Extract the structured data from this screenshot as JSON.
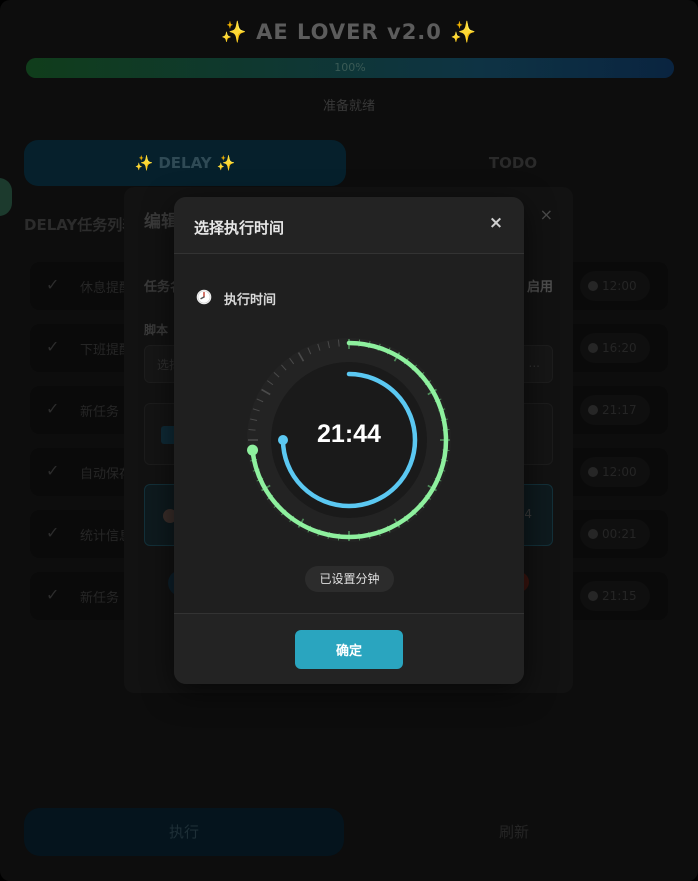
{
  "app": {
    "title": "✨ AE LOVER v2.0 ✨",
    "progress": {
      "percent": 100,
      "text": "100%"
    },
    "status": "准备就绪",
    "tabs": [
      {
        "label": "✨ DELAY ✨",
        "active": true
      },
      {
        "label": "TODO",
        "active": false
      }
    ],
    "section_title": "DELAY任务列表",
    "tasks": [
      {
        "name": "休息提醒",
        "time": "12:00"
      },
      {
        "name": "下班提醒",
        "time": "16:20"
      },
      {
        "name": "新任务",
        "time": "21:17"
      },
      {
        "name": "自动保存",
        "time": "12:00"
      },
      {
        "name": "统计信息",
        "time": "00:21"
      },
      {
        "name": "新任务",
        "time": "21:15"
      }
    ],
    "buttons": {
      "run": "执行",
      "refresh": "刷新"
    }
  },
  "edit_dialog": {
    "title": "编辑任务",
    "close": "×",
    "task_label": "任务名称",
    "enable_label": "启用",
    "script_label": "脚本",
    "script_value": "选择脚本",
    "script_more": "...",
    "row_value": "44"
  },
  "time_picker": {
    "title": "选择执行时间",
    "close": "×",
    "exec_label": "执行时间",
    "time": "21:44",
    "hour": 21,
    "minute": 44,
    "hint": "已设置分钟",
    "confirm": "确定",
    "colors": {
      "outer_ring": "#8ef09e",
      "inner_ring": "#5bc8f2",
      "confirm_bg": "#2aa5bf"
    }
  }
}
